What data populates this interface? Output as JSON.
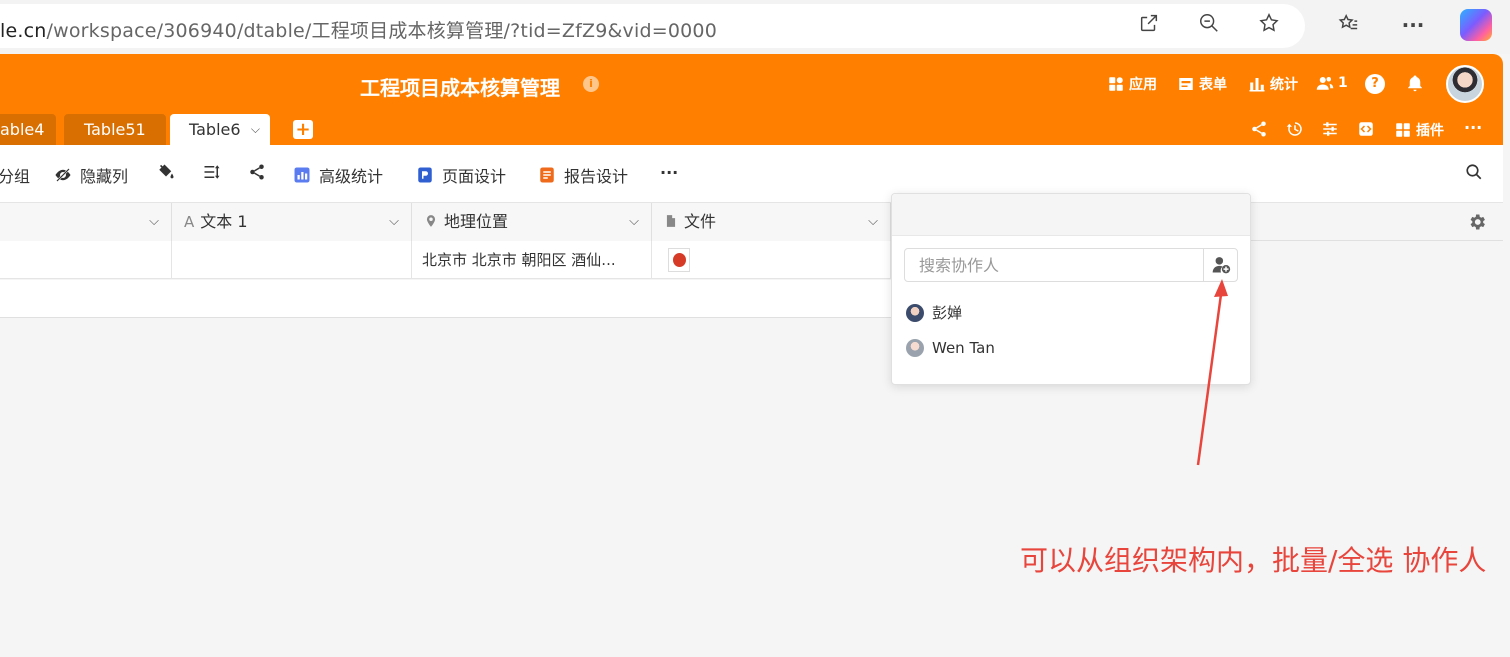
{
  "browser": {
    "url_host": "le.cn",
    "url_path": "/workspace/306940/dtable/工程项目成本核算管理/?tid=ZfZ9&vid=0000"
  },
  "header": {
    "title": "工程项目成本核算管理",
    "info_icon": "i",
    "apps_label": "应用",
    "form_label": "表单",
    "stats_label": "统计",
    "collaborators_count": "1",
    "help_label": "?",
    "plugins_label": "插件"
  },
  "tabs": [
    {
      "label": "able4",
      "active": false
    },
    {
      "label": "Table51",
      "active": false
    },
    {
      "label": "Table6",
      "active": true
    }
  ],
  "tab_add": "+",
  "toolbar": {
    "group_label": "分组",
    "hide_columns_label": "隐藏列",
    "advanced_stats_label": "高级统计",
    "page_design_label": "页面设计",
    "report_design_label": "报告设计",
    "more_label": "···"
  },
  "columns": [
    {
      "label": ""
    },
    {
      "label": "文本 1",
      "icon": "A"
    },
    {
      "label": "地理位置"
    },
    {
      "label": "文件"
    }
  ],
  "row": {
    "location": "北京市 北京市 朝阳区 酒仙..."
  },
  "popup": {
    "search_placeholder": "搜索协作人",
    "members": [
      {
        "name": "彭婵"
      },
      {
        "name": "Wen Tan"
      }
    ]
  },
  "annotation": {
    "text": "可以从组织架构内，批量/全选 协作人"
  },
  "colors": {
    "brand": "#ff8000",
    "annotation": "#e8453c"
  }
}
